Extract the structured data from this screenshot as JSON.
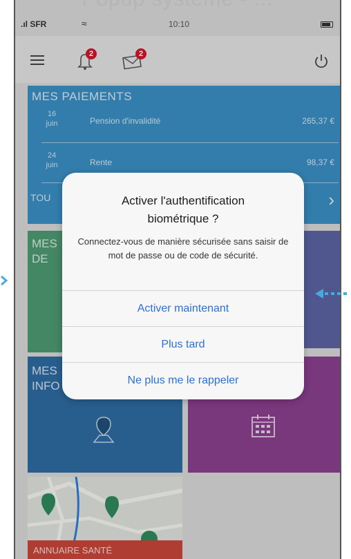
{
  "caption": "Popup système - ...",
  "status_bar": {
    "carrier": "SFR",
    "time": "10:10"
  },
  "header": {
    "notification_badge": "2",
    "mail_badge": "2",
    "icons": [
      "menu-icon",
      "bell-icon",
      "mail-icon",
      "power-icon"
    ]
  },
  "payments": {
    "heading": "MES PAIEMENTS",
    "rows": [
      {
        "day": "16",
        "month": "juin",
        "label": "Pension d'invalidité",
        "amount": "265,37 €"
      },
      {
        "day": "24",
        "month": "juin",
        "label": "Rente",
        "amount": "98,37 €"
      }
    ],
    "all_link": "TOU"
  },
  "tiles": {
    "green_heading": [
      "MES",
      "DE"
    ],
    "info_heading": [
      "MES",
      "INFO"
    ],
    "map_footer": "ANNUAIRE SANTÉ"
  },
  "dialog": {
    "title": "Activer l'authentification biométrique ?",
    "message": "Connectez-vous de manière sécurisée sans saisir de mot de passe ou de code de sécurité.",
    "buttons": [
      "Activer maintenant",
      "Plus tard",
      "Ne plus me le rappeler"
    ]
  },
  "colors": {
    "payments": "#3a8fc4",
    "green": "#4d9a72",
    "violet": "#5c63a3",
    "info": "#2e6ba1",
    "calendar": "#8a3f8e",
    "map_bar": "#c9463a",
    "badge": "#d0192a",
    "link": "#2f6fd0",
    "annotation_arrow": "#4aa8dc"
  }
}
